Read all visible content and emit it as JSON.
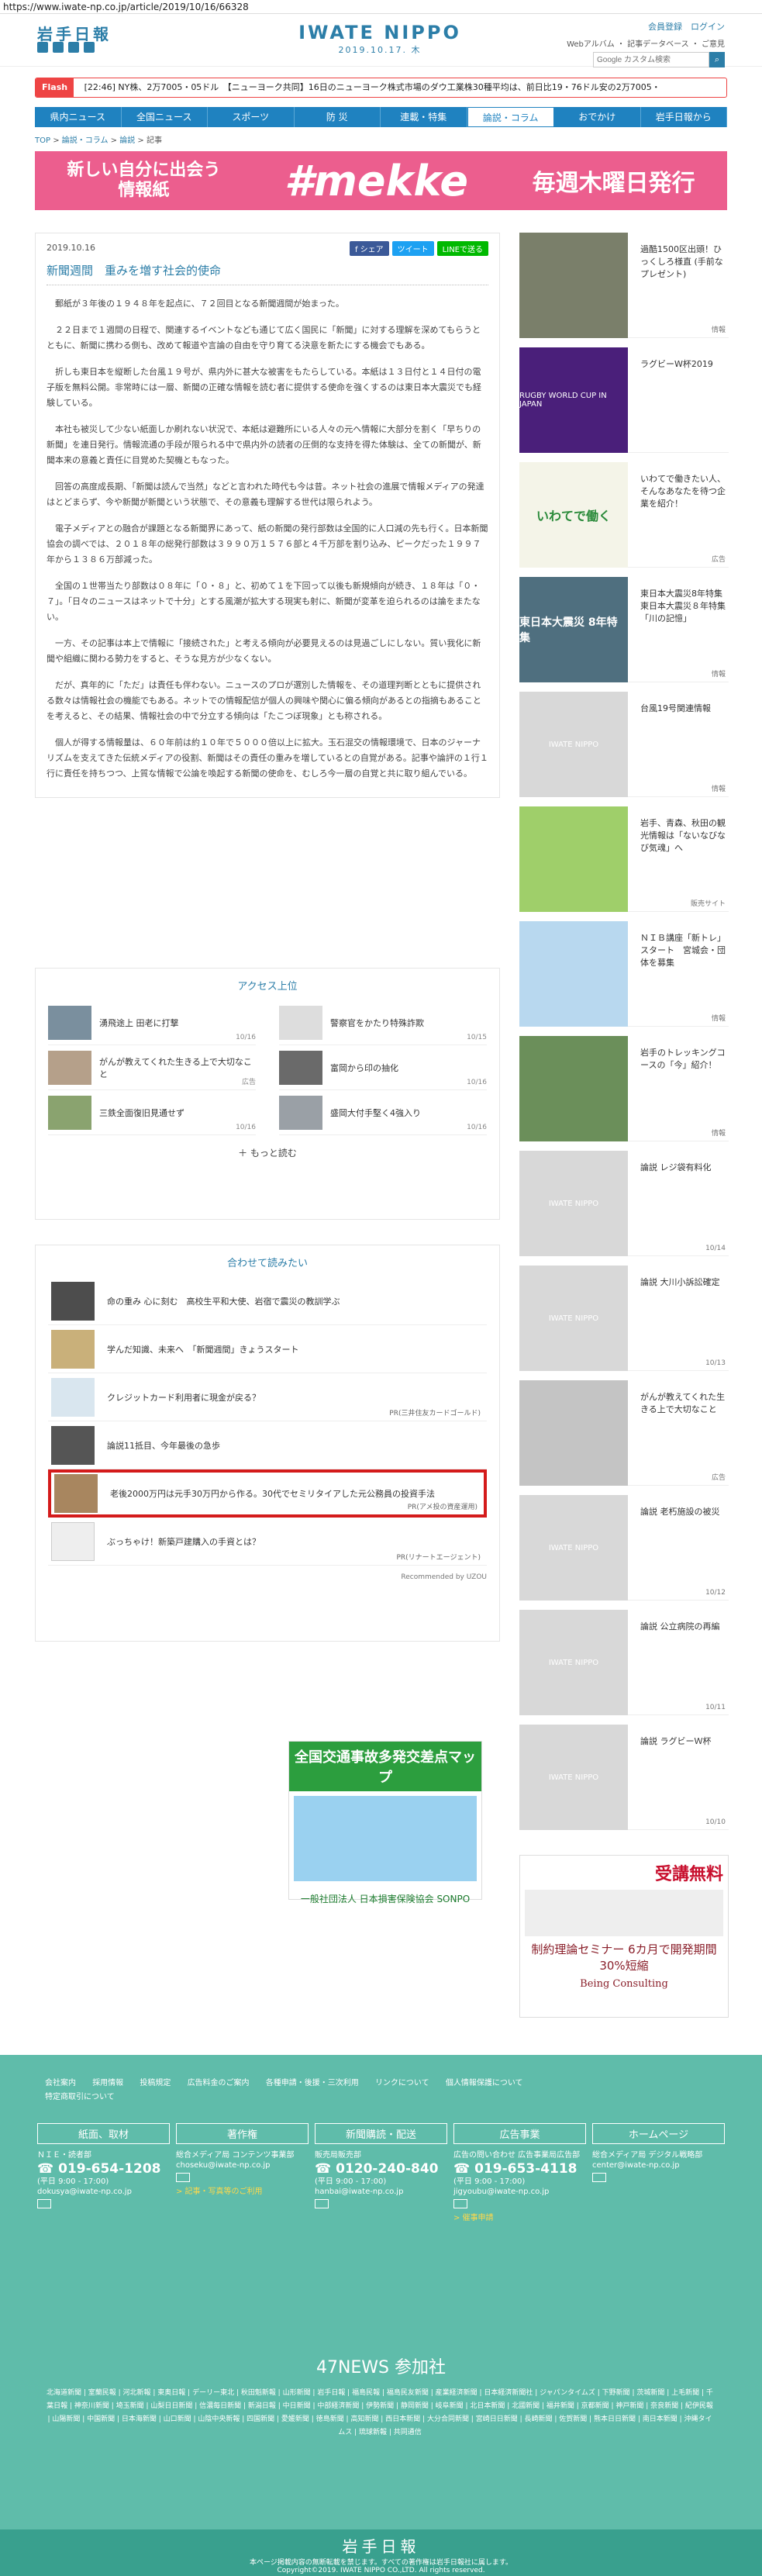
{
  "url": "https://www.iwate-np.co.jp/article/2019/10/16/66328",
  "header": {
    "logo": "岩手日報",
    "brand": "IWATE NIPPO",
    "date": "2019.10.17. 木",
    "links": "会員登録　ログイン",
    "sublinks": "Webアルバム ・ 記事データベース ・ ご意見",
    "search_placeholder": "Google カスタム検索"
  },
  "flash": {
    "tag": "Flash",
    "text": "[22:46] NY株、2万7005・05ドル　【ニューヨーク共同】16日のニューヨーク株式市場のダウ工業株30種平均は、前日比19・76ドル安の2万7005・"
  },
  "nav": [
    "県内ニュース",
    "全国ニュース",
    "スポーツ",
    "防 災",
    "連載・特集",
    "論説・コラム",
    "おでかけ",
    "岩手日報から"
  ],
  "crumb": [
    "TOP",
    "論説・コラム",
    "論説",
    "記事"
  ],
  "banner": {
    "left": "新しい自分に出会う\n情報紙",
    "mid": "#mekke",
    "right": "毎週木曜日発行"
  },
  "article": {
    "date": "2019.10.16",
    "title": "新聞週間　重みを増す社会的使命",
    "share": [
      "f シェア",
      "ツイート",
      "LINEで送る"
    ],
    "paras": [
      "郵紙が３年後の１９４８年を起点に、７２回目となる新聞週間が始まった。",
      "２２日まで１週間の日程で、関連するイベントなども通じて広く国民に「新聞」に対する理解を深めてもらうとともに、新聞に携わる側も、改めて報道や言論の自由を守り育てる決意を新たにする機会でもある。",
      "折しも東日本を縦断した台風１９号が、県内外に甚大な被害をもたらしている。本紙は１３日付と１４日付の電子版を無料公開。非常時には一層、新聞の正確な情報を読む者に提供する使命を強くするのは東日本大震災でも経験している。",
      "本社も被災して少ない紙面しか刷れない状況で、本紙は避難所にいる人々の元へ情報に大部分を割く「早ちりの新聞」を連日発行。情報流通の手段が限られる中で県内外の読者の圧倒的な支持を得た体験は、全ての新聞が、新聞本来の意義と責任に目覚めた契機ともなった。",
      "回答の高度成長期、「新聞は読んで当然」などと言われた時代も今は昔。ネット社会の進展で情報メディアの発達はとどまらず、今や新聞が新聞という状態で、その意義も理解する世代は限られよう。",
      "電子メディアとの融合が課題となる新聞界にあって、紙の新聞の発行部数は全国的に人口減の先も行く。日本新聞協会の調べでは、２０１８年の総発行部数は３９９０万１５７６部と４千万部を割り込み、ピークだった１９９７年から１３８６万部減った。",
      "全国の１世帯当たり部数は０８年に「０・８」と、初めて１を下回って以後も新規傾向が続き、１８年は「０・７」。「日々のニュースはネットで十分」とする風潮が拡大する現実も射に、新聞が変革を迫られるのは論をまたない。",
      "一方、その記事は本上で情報に「接続された」と考える傾向が必要見えるのは見過ごしにしない。質い我化に新聞や組織に関わる勢力をすると、そうな見方が少なくない。",
      "だが、真年的に「ただ」は責任も伴わない。ニュースのプロが選別した情報を、その道理判断とともに提供される数々は情報社会の機能でもある。ネットでの情報配信が個人の興味や関心に偏る傾向があるとの指摘もあることを考えると、その結果、情報社会の中で分立する傾向は「たこつぼ現象」とも称される。",
      "個人が得する情報量は、６０年前は約１０年で５０００倍以上に拡大。玉石混交の情報環境で、日本のジャーナリズムを支えてきた伝統メディアの役割、新聞はその責任の重みを増しているとの自覚がある。記事や論評の１行１行に責任を持ちつつ、上質な情報で公論を喚起する新聞の使命を、むしろ今一層の自覚と共に取り組んでいる。"
    ]
  },
  "ranking": {
    "title": "アクセス上位",
    "items": [
      {
        "t": "湧飛途上 田老に打撃",
        "d": "10/16"
      },
      {
        "t": "警察官をかたり特殊詐欺",
        "d": "10/15"
      },
      {
        "t": "がんが教えてくれた生きる上で大切なこと",
        "d": "広告"
      },
      {
        "t": "富岡から印の抽化",
        "d": "10/16"
      },
      {
        "t": "三鉄全面復旧見通せず",
        "d": "10/16"
      },
      {
        "t": "盛岡大付手堅く4強入り",
        "d": "10/16"
      }
    ],
    "more": "もっと読む"
  },
  "recommend": {
    "title": "合わせて読みたい",
    "items": [
      {
        "t": "命の重み 心に刻む　高校生平和大使、岩宿で震災の教訓学ぶ",
        "pr": ""
      },
      {
        "t": "学んだ知識、未来へ　「新聞週間」きょうスタート",
        "pr": ""
      },
      {
        "t": "クレジットカード利用者に現金が戻る？",
        "pr": "PR(三井住友カードゴールド)"
      },
      {
        "t": "論説11抵目、今年最後の急歩",
        "pr": ""
      },
      {
        "t": "老後2000万円は元手30万円から作る。30代でセミリタイアした元公務員の投資手法",
        "pr": "PR(アメ投の資産運用)"
      },
      {
        "t": "ぶっちゃけ！新築戸建購入の手資とは？",
        "pr": "PR(リナートエージェント)"
      }
    ],
    "powered": "Recommended by UZOU"
  },
  "side": [
    {
      "t": "過酷1500区出頭！ひっくしろ様直 (手前なプレゼント)",
      "c": "情報"
    },
    {
      "t": "ラグビーW杯2019",
      "c": "",
      "img": "RUGBY WORLD CUP IN JAPAN"
    },
    {
      "t": "いわてで働きたい人、そんなあなたを待つ企業を紹介！",
      "c": "広告",
      "img": "いわてで働く"
    },
    {
      "t": "東日本大震災8年特集　東日本大震災８年特集「川の記憶」",
      "c": "情報",
      "img": "東日本大震災 8年特集"
    },
    {
      "t": "台風19号関連情報",
      "c": "情報",
      "img": "IWATE NIPPO"
    },
    {
      "t": "岩手、青森、秋田の観光情報は「ないなびなび気魂」へ",
      "c": "販売サイト"
    },
    {
      "t": "ＮＩＢ講座「新トレ」スタート　宮城会・団体を募集",
      "c": "情報"
    },
    {
      "t": "岩手のトレッキングコースの「今」紹介！",
      "c": "情報"
    },
    {
      "t": "論説 レジ袋有料化",
      "c": "10/14",
      "img": "IWATE NIPPO"
    },
    {
      "t": "論説 大川小訴訟確定",
      "c": "10/13",
      "img": "IWATE NIPPO"
    },
    {
      "t": "がんが教えてくれた生きる上で大切なこと",
      "c": "広告"
    },
    {
      "t": "論説 老朽施設の被災",
      "c": "10/12",
      "img": "IWATE NIPPO"
    },
    {
      "t": "論説 公立病院の再編",
      "c": "10/11",
      "img": "IWATE NIPPO"
    },
    {
      "t": "論説 ラグビーＷ杯",
      "c": "10/10",
      "img": "IWATE NIPPO"
    }
  ],
  "ads": {
    "traffic": "全国交通事故多発交差点マップ",
    "traffic_sub": "一般社団法人 日本損害保険協会 SONPO",
    "seminar_top": "受講無料",
    "seminar": "制約理論セミナー 6カ月で開発期間30%短縮",
    "seminar_brand": "Being Consulting"
  },
  "footer": {
    "links": [
      "会社案内",
      "採用情報",
      "投稿規定",
      "広告料金のご案内",
      "各種申請・後援・三次利用",
      "リンクについて",
      "個人情報保護について",
      "特定商取引について"
    ],
    "cols": [
      {
        "h": "紙面、取材",
        "sub": "ＮＩＥ・読者部",
        "tel": "019-654-1208",
        "hours": "(平日 9:00 - 17:00)",
        "mail": "dokusya@iwate-np.co.jp",
        "extra": ""
      },
      {
        "h": "著作権",
        "sub": "総合メディア局 コンテンツ事業部",
        "tel": "",
        "hours": "",
        "mail": "choseku@iwate-np.co.jp",
        "extra": "> 記事・写真等のご利用"
      },
      {
        "h": "新聞購読・配送",
        "sub": "販売局販売部",
        "tel": "0120-240-840",
        "hours": "(平日 9:00 - 17:00)",
        "mail": "hanbai@iwate-np.co.jp",
        "extra": ""
      },
      {
        "h": "広告事業",
        "sub": "広告の問い合わせ 広告事業局広告部",
        "tel": "019-653-4118",
        "hours": "(平日 9:00 - 17:00)",
        "mail": "jigyoubu@iwate-np.co.jp",
        "extra": "> 催事申請"
      },
      {
        "h": "ホームページ",
        "sub": "総合メディア局 デジタル戦略部",
        "tel": "",
        "hours": "",
        "mail": "center@iwate-np.co.jp",
        "extra": ""
      }
    ],
    "n47": "47NEWS 参加社",
    "n47list": "北海道新聞 | 室蘭民報 | 河北新報 | 東奥日報 | デーリー東北 | 秋田魁新報 | 山形新聞 | 岩手日報 | 福島民報 | 福島民友新聞 | 産業経済新聞 | 日本経済新聞社 | ジャパンタイムズ | 下野新聞 | 茨城新聞 | 上毛新聞 | 千葉日報 | 神奈川新聞 | 埼玉新聞 | 山梨日日新聞 | 信濃毎日新聞 | 新潟日報 | 中日新聞 | 中部経済新聞 | 伊勢新聞 | 静岡新聞 | 岐阜新聞 | 北日本新聞 | 北國新聞 | 福井新聞 | 京都新聞 | 神戸新聞 | 奈良新聞 | 紀伊民報 | 山陽新聞 | 中国新聞 | 日本海新聞 | 山口新聞 | 山陰中央新報 | 四国新聞 | 愛媛新聞 | 徳島新聞 | 高知新聞 | 西日本新聞 | 大分合同新聞 | 宮崎日日新聞 | 長崎新聞 | 佐賀新聞 | 熊本日日新聞 | 南日本新聞 | 沖縄タイムス | 琉球新報 | 共同通信",
    "logo": "岩手日報",
    "note": "本ページ掲載内容の無断転載を禁じます。すべての著作権は岩手日報社に属します。",
    "copy": "Copyright©2019. IWATE NIPPO CO.,LTD. All rights reserved."
  }
}
